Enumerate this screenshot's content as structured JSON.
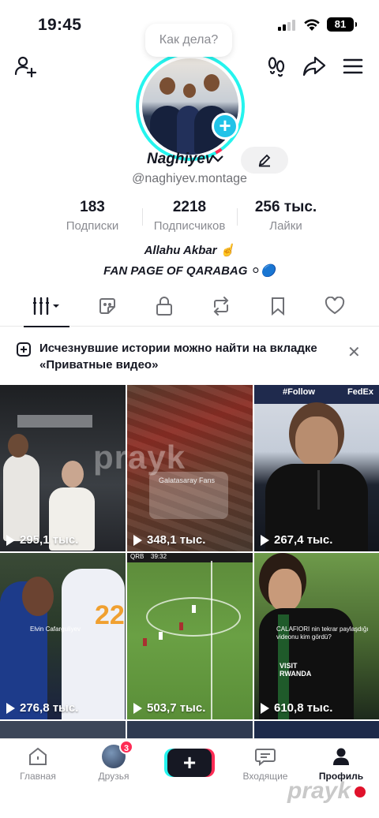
{
  "status_bar": {
    "time": "19:45",
    "battery": "81"
  },
  "profile": {
    "bubble_text": "Как дела?",
    "username": "Naghiyev",
    "handle": "@naghiyev.montage",
    "stats": [
      {
        "value": "183",
        "label": "Подписки"
      },
      {
        "value": "2218",
        "label": "Подписчиков"
      },
      {
        "value": "256 тыс.",
        "label": "Лайки"
      }
    ],
    "bio_line1": "Allahu Akbar ☝️",
    "bio_line2": "FAN PAGE OF QARABAG ⚪🔵"
  },
  "notice": {
    "text": "Исчезнувшие истории можно найти на вкладке «Приватные видео»"
  },
  "videos": [
    {
      "views": "295,1 тыс."
    },
    {
      "views": "348,1 тыс."
    },
    {
      "views": "267,4 тыс."
    },
    {
      "views": "276,8 тыс."
    },
    {
      "views": "503,7 тыс."
    },
    {
      "views": "610,8 тыс."
    }
  ],
  "video_overlays": {
    "tile2_caption": "Galatasaray Fans",
    "tile4_caption": "Elvin Cafarguliyev",
    "tile5_score": "QRB",
    "tile5_clock": "39:32",
    "tile6_caption": "CALAFIORI nin tekrar paylaşdığı videonu kim gördü?",
    "tile6_sponsor": "VISIT RWANDA",
    "tile3_sponsor_a": "#Follow",
    "tile3_sponsor_b": "FedEx"
  },
  "watermark": "prayk",
  "bottom_nav": {
    "home": "Главная",
    "friends": "Друзья",
    "friends_badge": "3",
    "inbox": "Входящие",
    "profile": "Профиль"
  }
}
